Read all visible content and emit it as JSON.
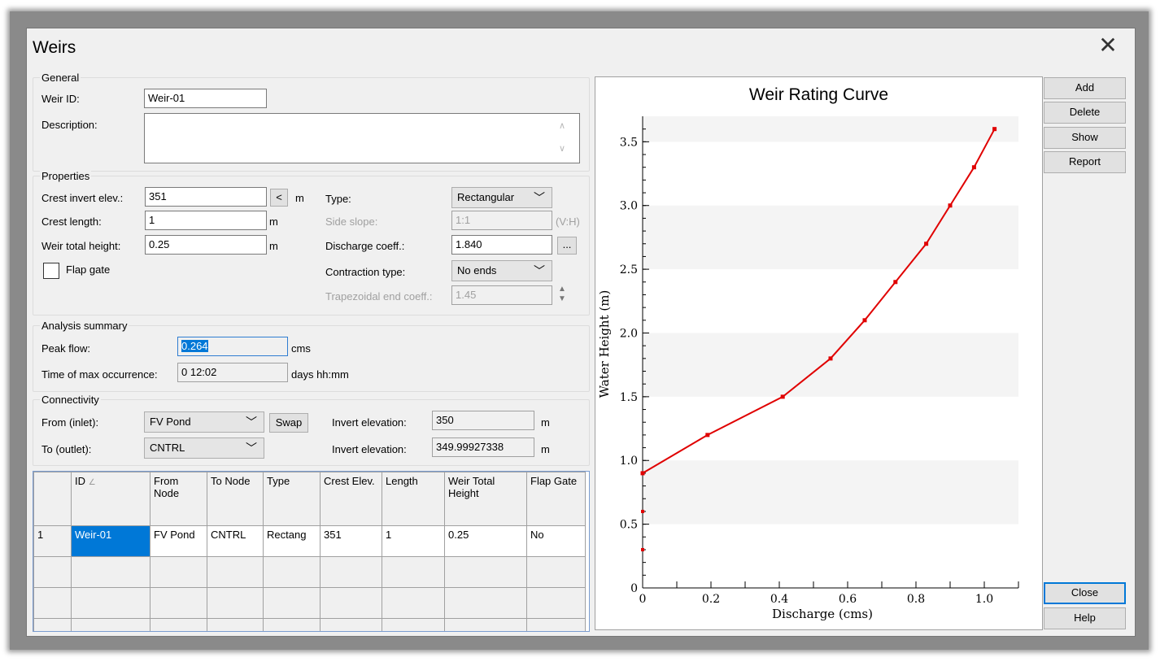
{
  "window": {
    "title": "Weirs",
    "close_glyph": "✕"
  },
  "general": {
    "group_label": "General",
    "weir_id_label": "Weir ID:",
    "weir_id_value": "Weir-01",
    "description_label": "Description:",
    "description_value": ""
  },
  "properties": {
    "group_label": "Properties",
    "crest_invert_label": "Crest invert elev.:",
    "crest_invert_value": "351",
    "crest_invert_btn": "<",
    "crest_invert_unit": "m",
    "crest_length_label": "Crest length:",
    "crest_length_value": "1",
    "crest_length_unit": "m",
    "weir_height_label": "Weir total height:",
    "weir_height_value": "0.25",
    "weir_height_unit": "m",
    "flap_gate_label": "Flap gate",
    "type_label": "Type:",
    "type_value": "Rectangular",
    "side_slope_label": "Side slope:",
    "side_slope_value": "1:1",
    "side_slope_unit": "(V:H)",
    "discharge_coeff_label": "Discharge coeff.:",
    "discharge_coeff_value": "1.840",
    "ellipsis_btn": "...",
    "contraction_label": "Contraction type:",
    "contraction_value": "No ends",
    "trap_end_label": "Trapezoidal end coeff.:",
    "trap_end_value": "1.45"
  },
  "analysis": {
    "group_label": "Analysis summary",
    "peak_flow_label": "Peak flow:",
    "peak_flow_value": "0.264",
    "peak_flow_unit": "cms",
    "time_max_label": "Time of max occurrence:",
    "time_max_value": "0  12:02",
    "time_max_unit": "days hh:mm"
  },
  "connectivity": {
    "group_label": "Connectivity",
    "from_label": "From (inlet):",
    "from_value": "FV Pond",
    "swap_btn": "Swap",
    "to_label": "To (outlet):",
    "to_value": "CNTRL",
    "invert1_label": "Invert elevation:",
    "invert1_value": "350",
    "invert1_unit": "m",
    "invert2_label": "Invert elevation:",
    "invert2_value": "349.99927338",
    "invert2_unit": "m"
  },
  "table": {
    "headers": [
      "ID",
      "From Node",
      "To Node",
      "Type",
      "Crest Elev.",
      "Length",
      "Weir Total Height",
      "Flap Gate"
    ],
    "rows": [
      {
        "num": "1",
        "cells": [
          "Weir-01",
          "FV Pond",
          "CNTRL",
          "Rectang",
          "351",
          "1",
          "0.25",
          "No"
        ]
      }
    ]
  },
  "buttons": {
    "add": "Add",
    "delete": "Delete",
    "show": "Show",
    "report": "Report",
    "close": "Close",
    "help": "Help"
  },
  "chart_data": {
    "type": "line",
    "title": "Weir Rating Curve",
    "xlabel": "Discharge (cms)",
    "ylabel": "Water Height (m)",
    "xlim": [
      0,
      1.1
    ],
    "ylim": [
      0,
      3.7
    ],
    "xticks": [
      "0",
      "0.2",
      "0.4",
      "0.6",
      "0.8",
      "1.0"
    ],
    "yticks": [
      "0",
      "0.5",
      "1.0",
      "1.5",
      "2.0",
      "2.5",
      "3.0",
      "3.5"
    ],
    "grid": "horizontal bands",
    "line_color": "#e00000",
    "series": [
      {
        "x": [
          0,
          0.19,
          0.41,
          0.55,
          0.65,
          0.74,
          0.83,
          0.9,
          0.97,
          1.03
        ],
        "y": [
          0.9,
          1.2,
          1.5,
          1.8,
          2.1,
          2.4,
          2.7,
          3.0,
          3.3,
          3.6
        ]
      }
    ],
    "extra_points": [
      {
        "x": 0,
        "y": 0.3
      },
      {
        "x": 0,
        "y": 0.6
      }
    ]
  }
}
